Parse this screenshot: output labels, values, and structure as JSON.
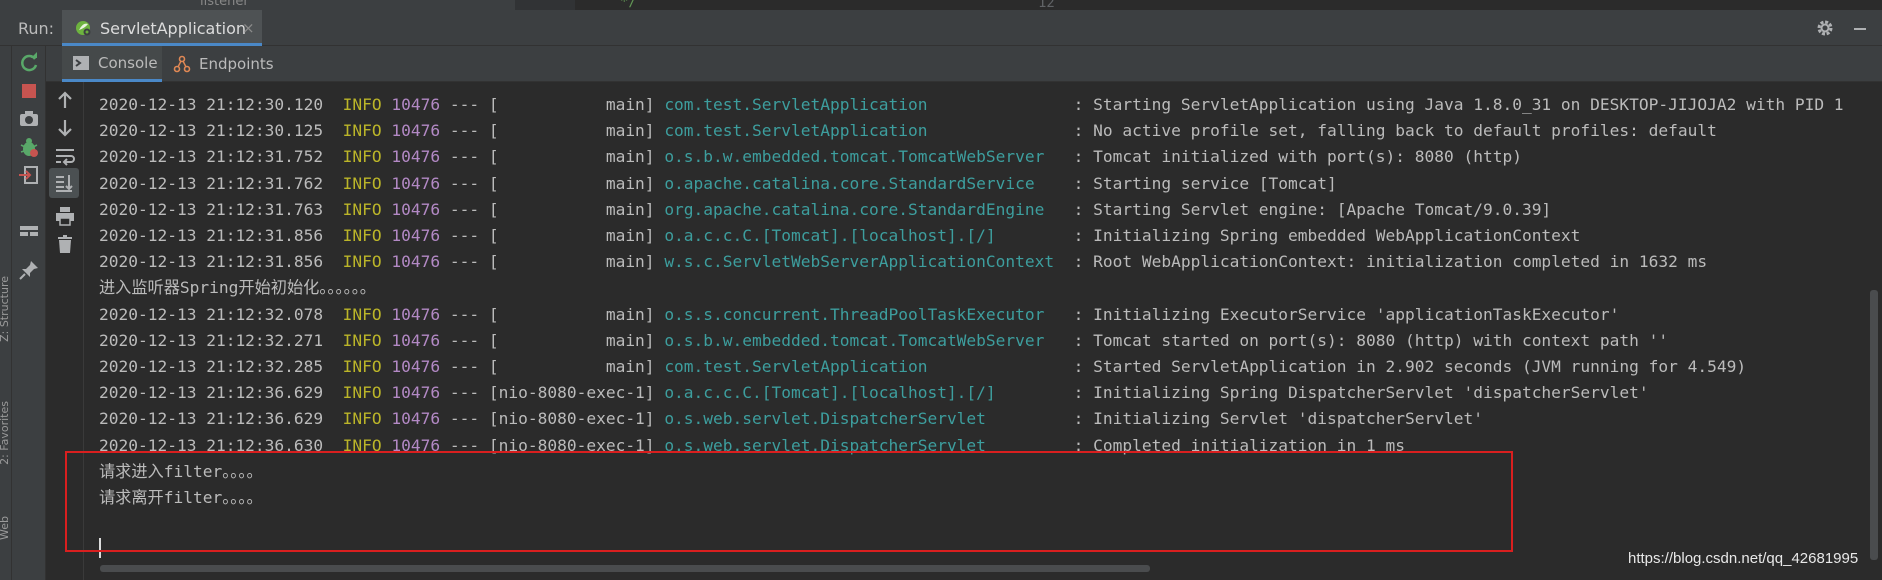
{
  "editor": {
    "line_number": "12",
    "code_fragment": "*/",
    "project_fragment": "listener"
  },
  "run_window": {
    "label": "Run:",
    "tab_title": "ServletApplication",
    "close_glyph": "×"
  },
  "sub_tabs": [
    {
      "label": "Console",
      "icon": "console-icon"
    },
    {
      "label": "Endpoints",
      "icon": "endpoints-icon"
    }
  ],
  "left_sidebar_labels": [
    "Z: Structure",
    "2: Favorites",
    "Web"
  ],
  "colors": {
    "accent": "#4a88c7",
    "info": "#bbb529",
    "pid": "#b389c5",
    "logger": "#3d9e9e",
    "highlight_box": "#d91f1f",
    "rerun": "#59a869",
    "stop": "#c75450"
  },
  "console": {
    "lines": [
      {
        "type": "log",
        "ts": "2020-12-13 21:12:30.120",
        "level": "INFO",
        "pid": "10476",
        "sep": "---",
        "thread": "[           main]",
        "logger": "com.test.ServletApplication              ",
        "msg": ": Starting ServletApplication using Java 1.8.0_31 on DESKTOP-JIJOJA2 with PID 1"
      },
      {
        "type": "log",
        "ts": "2020-12-13 21:12:30.125",
        "level": "INFO",
        "pid": "10476",
        "sep": "---",
        "thread": "[           main]",
        "logger": "com.test.ServletApplication              ",
        "msg": ": No active profile set, falling back to default profiles: default"
      },
      {
        "type": "log",
        "ts": "2020-12-13 21:12:31.752",
        "level": "INFO",
        "pid": "10476",
        "sep": "---",
        "thread": "[           main]",
        "logger": "o.s.b.w.embedded.tomcat.TomcatWebServer  ",
        "msg": ": Tomcat initialized with port(s): 8080 (http)"
      },
      {
        "type": "log",
        "ts": "2020-12-13 21:12:31.762",
        "level": "INFO",
        "pid": "10476",
        "sep": "---",
        "thread": "[           main]",
        "logger": "o.apache.catalina.core.StandardService   ",
        "msg": ": Starting service [Tomcat]"
      },
      {
        "type": "log",
        "ts": "2020-12-13 21:12:31.763",
        "level": "INFO",
        "pid": "10476",
        "sep": "---",
        "thread": "[           main]",
        "logger": "org.apache.catalina.core.StandardEngine  ",
        "msg": ": Starting Servlet engine: [Apache Tomcat/9.0.39]"
      },
      {
        "type": "log",
        "ts": "2020-12-13 21:12:31.856",
        "level": "INFO",
        "pid": "10476",
        "sep": "---",
        "thread": "[           main]",
        "logger": "o.a.c.c.C.[Tomcat].[localhost].[/]       ",
        "msg": ": Initializing Spring embedded WebApplicationContext"
      },
      {
        "type": "log",
        "ts": "2020-12-13 21:12:31.856",
        "level": "INFO",
        "pid": "10476",
        "sep": "---",
        "thread": "[           main]",
        "logger": "w.s.c.ServletWebServerApplicationContext ",
        "msg": ": Root WebApplicationContext: initialization completed in 1632 ms"
      },
      {
        "type": "text",
        "text": "进入监听器Spring开始初始化。。。。。。"
      },
      {
        "type": "log",
        "ts": "2020-12-13 21:12:32.078",
        "level": "INFO",
        "pid": "10476",
        "sep": "---",
        "thread": "[           main]",
        "logger": "o.s.s.concurrent.ThreadPoolTaskExecutor  ",
        "msg": ": Initializing ExecutorService 'applicationTaskExecutor'"
      },
      {
        "type": "log",
        "ts": "2020-12-13 21:12:32.271",
        "level": "INFO",
        "pid": "10476",
        "sep": "---",
        "thread": "[           main]",
        "logger": "o.s.b.w.embedded.tomcat.TomcatWebServer  ",
        "msg": ": Tomcat started on port(s): 8080 (http) with context path ''"
      },
      {
        "type": "log",
        "ts": "2020-12-13 21:12:32.285",
        "level": "INFO",
        "pid": "10476",
        "sep": "---",
        "thread": "[           main]",
        "logger": "com.test.ServletApplication              ",
        "msg": ": Started ServletApplication in 2.902 seconds (JVM running for 4.549)"
      },
      {
        "type": "log",
        "ts": "2020-12-13 21:12:36.629",
        "level": "INFO",
        "pid": "10476",
        "sep": "---",
        "thread": "[nio-8080-exec-1]",
        "logger": "o.a.c.c.C.[Tomcat].[localhost].[/]       ",
        "msg": ": Initializing Spring DispatcherServlet 'dispatcherServlet'"
      },
      {
        "type": "log",
        "ts": "2020-12-13 21:12:36.629",
        "level": "INFO",
        "pid": "10476",
        "sep": "---",
        "thread": "[nio-8080-exec-1]",
        "logger": "o.s.web.servlet.DispatcherServlet        ",
        "msg": ": Initializing Servlet 'dispatcherServlet'"
      },
      {
        "type": "log",
        "ts": "2020-12-13 21:12:36.630",
        "level": "INFO",
        "pid": "10476",
        "sep": "---",
        "thread": "[nio-8080-exec-1]",
        "logger": "o.s.web.servlet.DispatcherServlet        ",
        "msg": ": Completed initialization in 1 ms"
      },
      {
        "type": "text",
        "text": "请求进入filter。。。。"
      },
      {
        "type": "text",
        "text": "请求离开filter。。。。"
      }
    ]
  },
  "watermark": "https://blog.csdn.net/qq_42681995"
}
